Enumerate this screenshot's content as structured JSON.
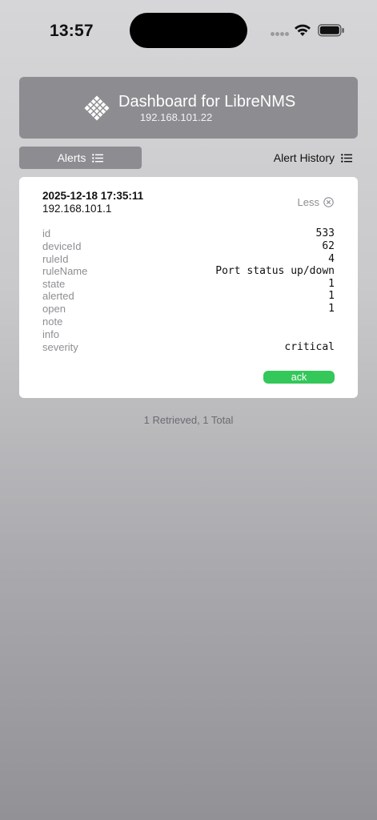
{
  "status_bar": {
    "time": "13:57",
    "wifi_icon": "wifi-icon",
    "battery_icon": "battery-icon"
  },
  "header": {
    "title": "Dashboard for LibreNMS",
    "subtitle": "192.168.101.22",
    "logo_icon": "librenms-logo-icon"
  },
  "tabs": {
    "alerts_label": "Alerts",
    "history_label": "Alert History",
    "tab_icon": "list-icon"
  },
  "alert": {
    "date": "2025-12-18 17:35:11",
    "host": "192.168.101.1",
    "toggle_label": "Less",
    "fields": [
      {
        "key": "id",
        "value": "533"
      },
      {
        "key": "deviceId",
        "value": "62"
      },
      {
        "key": "ruleId",
        "value": "4"
      },
      {
        "key": "ruleName",
        "value": "Port status up/down"
      },
      {
        "key": "state",
        "value": "1"
      },
      {
        "key": "alerted",
        "value": "1"
      },
      {
        "key": "open",
        "value": "1"
      },
      {
        "key": "note",
        "value": ""
      },
      {
        "key": "info",
        "value": ""
      },
      {
        "key": "severity",
        "value": "critical"
      }
    ],
    "ack_label": "ack"
  },
  "footer": {
    "count_text": "1 Retrieved, 1 Total"
  },
  "colors": {
    "accent_green": "#34c759",
    "header_gray": "#8d8d91",
    "muted_text": "#8e8e93"
  }
}
